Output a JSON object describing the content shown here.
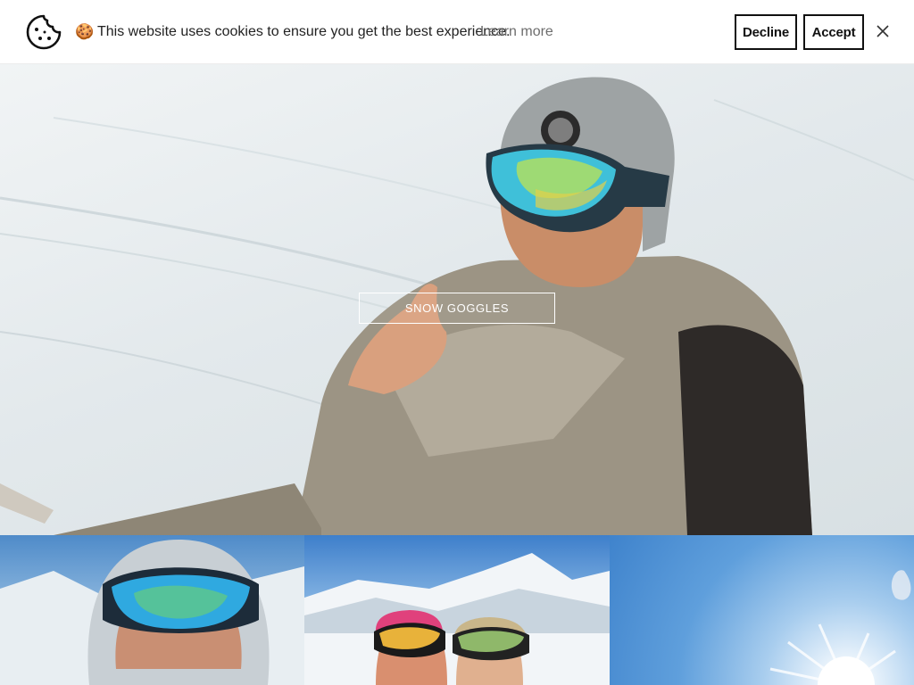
{
  "cookie_banner": {
    "emoji": "🍪",
    "message": "This website uses cookies to ensure you get the best experience.",
    "learn_more_label": "Learn more",
    "decline_label": "Decline",
    "accept_label": "Accept",
    "icon": "cookie-icon",
    "close_icon": "close-icon"
  },
  "hero": {
    "cta_label": "SNOW GOGGLES",
    "image": "skier-with-reflective-goggles"
  },
  "tiles": [
    {
      "image": "skier-closeup-blue-goggles"
    },
    {
      "image": "two-skiers-mountains"
    },
    {
      "image": "sun-sky-snow"
    }
  ],
  "colors": {
    "text": "#222222",
    "muted_link": "#6d6d6d",
    "button_border": "#111111",
    "background": "#ffffff"
  }
}
